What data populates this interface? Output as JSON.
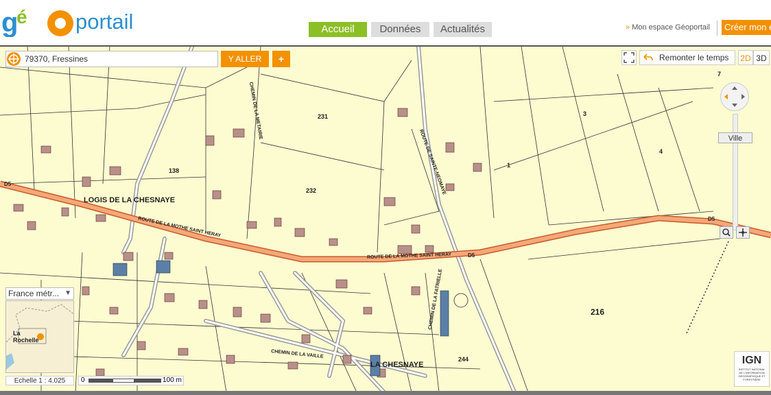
{
  "header": {
    "logo_text_geo": "géo",
    "logo_text_portail": "portail",
    "tabs": [
      {
        "label": "Accueil"
      },
      {
        "label": "Données"
      },
      {
        "label": "Actualités"
      }
    ],
    "mon_espace": "Mon espace Géoportail",
    "creer": "Créer mon e"
  },
  "search": {
    "value": "79370, Fressines",
    "go_label": "Y ALLER",
    "plus_label": "+"
  },
  "controls": {
    "remonter": "Remonter le temps",
    "btn_2d": "2D",
    "btn_3d": "3D",
    "zoom_level_label": "Ville"
  },
  "overview": {
    "select_value": "France métr...",
    "city_label": "La Rochelle"
  },
  "scale": {
    "echelle_label": "Echelle 1 :",
    "echelle_value": "4.025",
    "bar_start": "0",
    "bar_end": "100 m"
  },
  "map_labels": {
    "road1": "ROUTE DE LA MOTHE SAINT HERAY",
    "road2": "ROUTE DE LA MOTHE SAINT HERAY",
    "logis": "LOGIS DE LA CHESNAYE",
    "chesnaye": "LA CHESNAYE",
    "chemin_metairie": "CHEMIN DE LA METAIRIE",
    "chemin_vaille": "CHEMIN DE LA VAILLE",
    "route_ste": "ROUTE DE SAINTE-NEOMAYE",
    "chemin_fatrielle": "CHEMIN DE LA FATRIELLE",
    "d5a": "D5",
    "d5b": "D5",
    "d5c": "D5",
    "p231": "231",
    "p232": "232",
    "p138": "138",
    "p216": "216",
    "p244": "244",
    "p3": "3",
    "p4": "4",
    "p1": "1",
    "p7": "7"
  },
  "ign": {
    "text": "IGN",
    "sub": "INSTITUT NATIONAL DE L'INFORMATION GÉOGRAPHIQUE ET FORESTIÈRE"
  },
  "colors": {
    "accent": "#f39100",
    "tab_active": "#8cbf26",
    "map_bg": "#fdfbd0",
    "road": "#f0a060"
  }
}
